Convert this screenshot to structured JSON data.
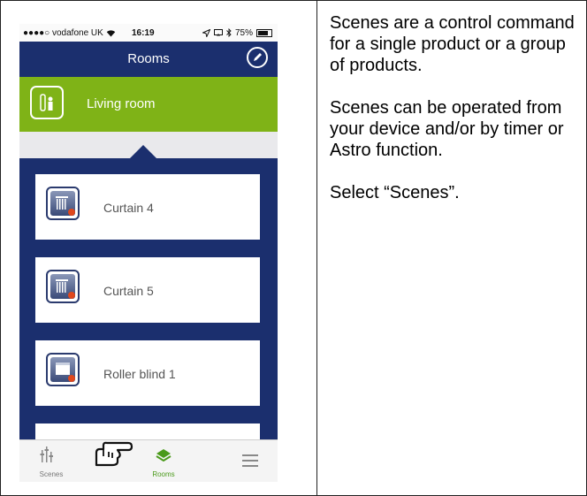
{
  "status_bar": {
    "carrier": "●●●●○ vodafone UK",
    "time": "16:19",
    "battery": "75%"
  },
  "nav": {
    "title": "Rooms"
  },
  "room": {
    "label": "Living room"
  },
  "devices": [
    {
      "label": "Curtain 4",
      "icon": "curtain-icon"
    },
    {
      "label": "Curtain 5",
      "icon": "curtain-icon"
    },
    {
      "label": "Roller blind 1",
      "icon": "roller-blind-icon"
    }
  ],
  "tabs": {
    "scenes": "Scenes",
    "rooms": "Rooms"
  },
  "instructions": {
    "p1": "Scenes are a control command for a single product or a group of products.",
    "p2": "Scenes can be operated from your device and/or by timer or Astro function.",
    "p3": "Select “Scenes”."
  },
  "colors": {
    "nav_blue": "#1b2f6e",
    "room_green": "#7fb317",
    "status_dot": "#e0481d",
    "active_tab": "#4a9a1a"
  }
}
